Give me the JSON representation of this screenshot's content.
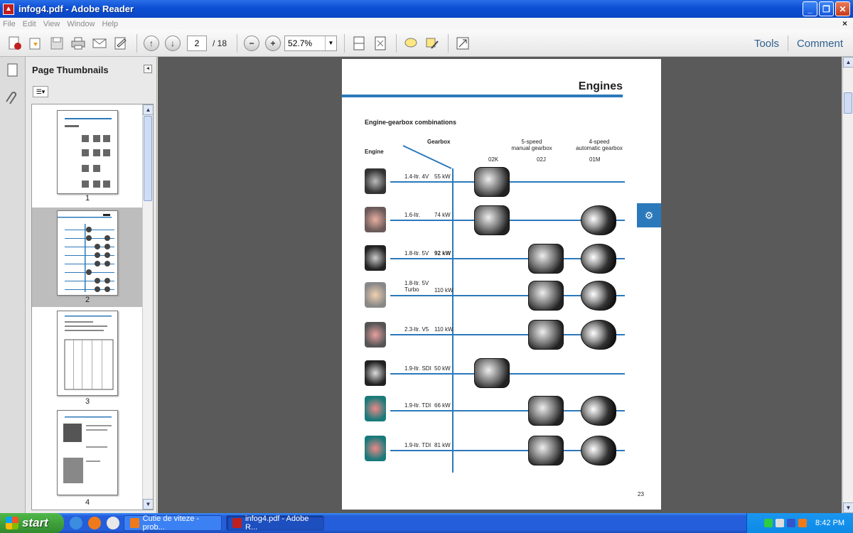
{
  "window": {
    "title": "infog4.pdf - Adobe Reader",
    "app_icon": "pdf-icon"
  },
  "menu": [
    "File",
    "Edit",
    "View",
    "Window",
    "Help"
  ],
  "toolbar": {
    "page_current": "2",
    "page_total": "/ 18",
    "zoom": "52.7%",
    "tools_label": "Tools",
    "comment_label": "Comment"
  },
  "thumbnails": {
    "panel_title": "Page Thumbnails",
    "pages": [
      "1",
      "2",
      "3",
      "4"
    ],
    "selected": "2"
  },
  "document": {
    "title": "Engines",
    "subtitle": "Engine-gearbox combinations",
    "col_gearbox": "Gearbox",
    "col_engine": "Engine",
    "manual_header": "5-speed\nmanual gearbox",
    "auto_header": "4-speed\nautomatic gearbox",
    "codes": [
      "02K",
      "02J",
      "01M"
    ],
    "page_number": "23",
    "rows": [
      {
        "engine": "1.4-ltr. 4V",
        "power": "55 kW",
        "gearboxes": [
          "02K"
        ]
      },
      {
        "engine": "1.6-ltr.",
        "power": "74 kW",
        "gearboxes": [
          "02K",
          "01M"
        ]
      },
      {
        "engine": "1.8-ltr. 5V",
        "power": "92 kW",
        "gearboxes": [
          "02J",
          "01M"
        ]
      },
      {
        "engine": "1.8-ltr. 5V Turbo",
        "power": "110 kW",
        "gearboxes": [
          "02J",
          "01M"
        ]
      },
      {
        "engine": "2.3-ltr. V5",
        "power": "110 kW",
        "gearboxes": [
          "02J",
          "01M"
        ]
      },
      {
        "engine": "1.9-ltr. SDI",
        "power": "50 kW",
        "gearboxes": [
          "02K"
        ]
      },
      {
        "engine": "1.9-ltr. TDI",
        "power": "66 kW",
        "gearboxes": [
          "02J",
          "01M"
        ]
      },
      {
        "engine": "1.9-ltr. TDI",
        "power": "81 kW",
        "gearboxes": [
          "02J",
          "01M"
        ]
      }
    ]
  },
  "taskbar": {
    "start_label": "start",
    "tasks": [
      {
        "label": "Cutie de viteze - prob...",
        "active": false
      },
      {
        "label": "infog4.pdf - Adobe R...",
        "active": true
      }
    ],
    "clock": "8:42 PM"
  },
  "colors": {
    "accent": "#2b79bb",
    "titlebar": "#0c4fd4",
    "pdf_red": "#c21f1f"
  }
}
